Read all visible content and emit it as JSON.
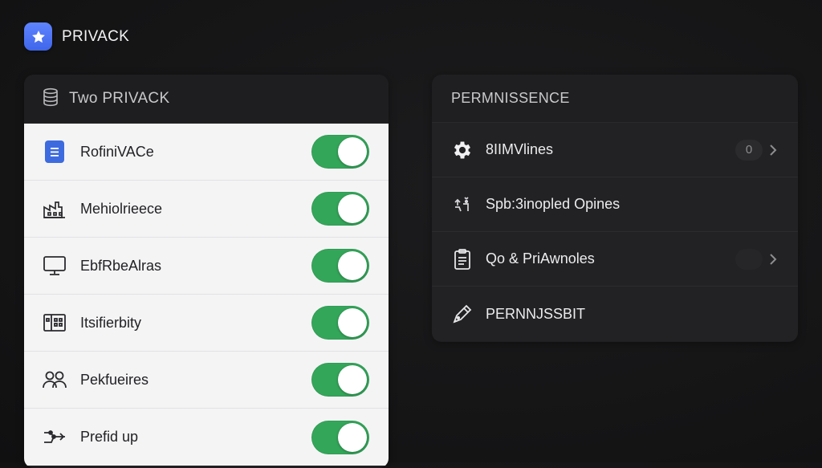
{
  "app": {
    "title": "PRIVACK",
    "logo_icon": "star-icon",
    "accent": "#4a70f2"
  },
  "left_panel": {
    "title": "Two PRIVACK",
    "header_icon": "database-icon",
    "toggle_color": "#34a65a",
    "items": [
      {
        "label": "RofiniVACe",
        "icon": "document-icon",
        "on": true
      },
      {
        "label": "Mehiolrieece",
        "icon": "factory-icon",
        "on": true
      },
      {
        "label": "EbfRbeAlras",
        "icon": "monitor-icon",
        "on": true
      },
      {
        "label": "Itsifierbity",
        "icon": "building-icon",
        "on": true
      },
      {
        "label": "Pekfueires",
        "icon": "people-icon",
        "on": true
      },
      {
        "label": "Prefid up",
        "icon": "network-icon",
        "on": true
      }
    ]
  },
  "right_panel": {
    "title": "PERMNISSENCE",
    "items": [
      {
        "label": "8IIMVlines",
        "icon": "gear-icon",
        "badge": "0",
        "chevron": true
      },
      {
        "label": "Spb:3inopled Opines",
        "icon": "share-icon",
        "badge": "",
        "chevron": false
      },
      {
        "label": "Qo & PriAwnoles",
        "icon": "clipboard-icon",
        "badge": "",
        "chevron": true
      },
      {
        "label": "PERNNJSSBIT",
        "icon": "pen-icon",
        "badge": "",
        "chevron": false
      }
    ]
  }
}
